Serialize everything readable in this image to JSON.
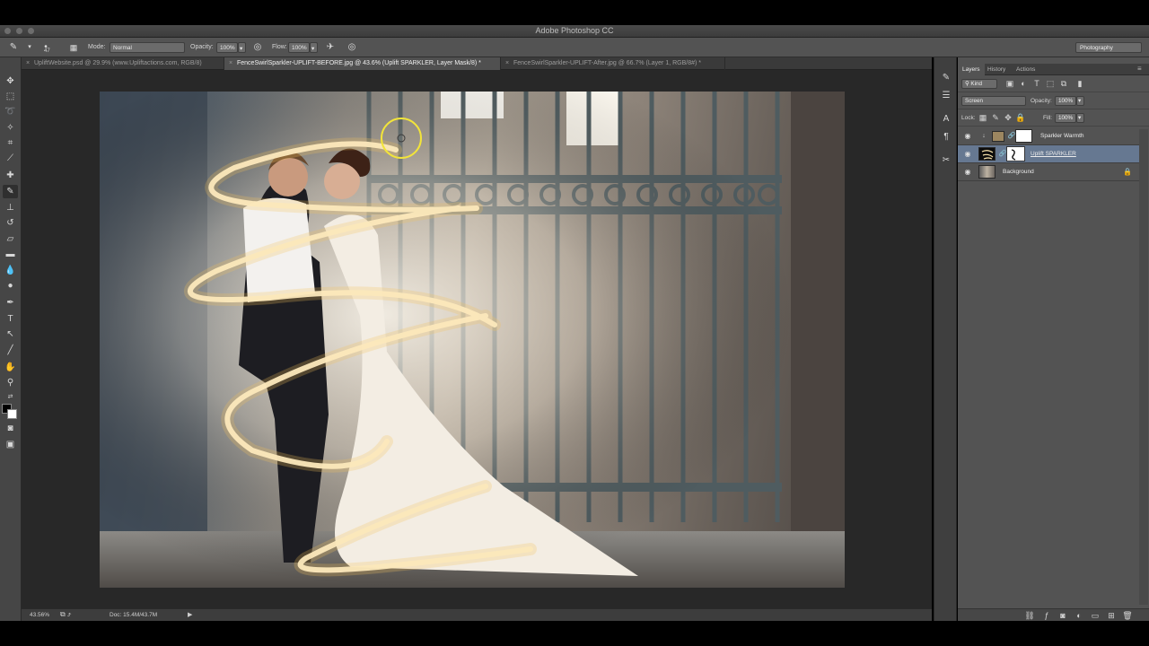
{
  "app": {
    "title": "Adobe Photoshop CC"
  },
  "options_bar": {
    "brush_size": "47",
    "mode_label": "Mode:",
    "mode_value": "Normal",
    "opacity_label": "Opacity:",
    "opacity_value": "100%",
    "flow_label": "Flow:",
    "flow_value": "100%",
    "workspace": "Photography"
  },
  "tabs": [
    {
      "label": "UpliftWebsite.psd @ 29.9% (www.Upliftactions.com, RGB/8)"
    },
    {
      "label": "FenceSwirlSparkler-UPLIFT-BEFORE.jpg @ 43.6% (Uplift SPARKLER, Layer Mask/8) *"
    },
    {
      "label": "FenceSwirlSparkler-UPLIFT-After.jpg @ 66.7% (Layer 1, RGB/8#) *"
    }
  ],
  "status": {
    "zoom": "43.56%",
    "doc": "Doc: 15.4M/43.7M"
  },
  "layers_panel": {
    "tabs": [
      "Layers",
      "History",
      "Actions"
    ],
    "kind_label": "Kind",
    "blend_mode": "Screen",
    "opacity_label": "Opacity:",
    "opacity_value": "100%",
    "lock_label": "Lock:",
    "fill_label": "Fill:",
    "fill_value": "100%",
    "layers": [
      {
        "name": "Sparkler Warmth",
        "selected": false
      },
      {
        "name": "Uplift SPARKLER",
        "selected": true
      },
      {
        "name": "Background",
        "selected": false
      }
    ]
  },
  "colors": {
    "selected_layer": "#667891",
    "panel_bg": "#535353",
    "brush_cursor": "#f2e43a",
    "foreground": "#000000",
    "background": "#ffffff"
  }
}
